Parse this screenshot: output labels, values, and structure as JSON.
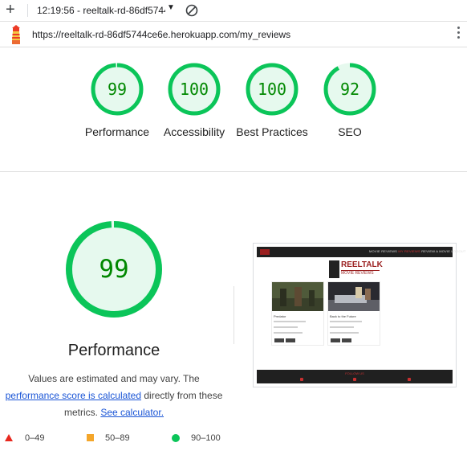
{
  "toolbar": {
    "new_label": "+",
    "report_title": "12:19:56 - reeltalk-rd-86df5744",
    "dropdown_caret": "▼"
  },
  "url_bar": {
    "url": "https://reeltalk-rd-86df5744ce6e.herokuapp.com/my_reviews"
  },
  "categories": [
    {
      "score": "99",
      "score_value": 99,
      "label": "Performance",
      "color": "#0bc559"
    },
    {
      "score": "100",
      "score_value": 100,
      "label": "Accessibility",
      "color": "#0bc559"
    },
    {
      "score": "100",
      "score_value": 100,
      "label": "Best Practices",
      "color": "#0bc559"
    },
    {
      "score": "92",
      "score_value": 92,
      "label": "SEO",
      "color": "#0bc559"
    }
  ],
  "performance": {
    "score": "99",
    "score_value": 99,
    "title": "Performance",
    "note_part1": "Values are estimated and may vary. The",
    "note_link1": "performance score is calculated",
    "note_part2": "directly from these metrics.",
    "note_link2": "See calculator."
  },
  "legend": [
    {
      "shape": "triangle",
      "color": "#e8281e",
      "label": "0–49"
    },
    {
      "shape": "square",
      "color": "#f4a62a",
      "label": "50–89"
    },
    {
      "shape": "circle",
      "color": "#0bc559",
      "label": "90–100"
    }
  ],
  "thumbnail": {
    "logo_text": "REELTALK",
    "logo_sub": "MOVIE REVIEWS",
    "nav_text": "MOVIE REVIEWS",
    "nav_active": "MY REVIEWS",
    "nav_rest": "REVIEW A MOVIE  LOGOUT",
    "cards": [
      {
        "title": "Predator"
      },
      {
        "title": "Back to the Future"
      }
    ],
    "footer_text": "FOLLOW US"
  },
  "colors": {
    "pass": "#0bc559",
    "pass_text": "#008800",
    "pass_fill": "#e6f9ee",
    "link": "#1a55d6"
  }
}
